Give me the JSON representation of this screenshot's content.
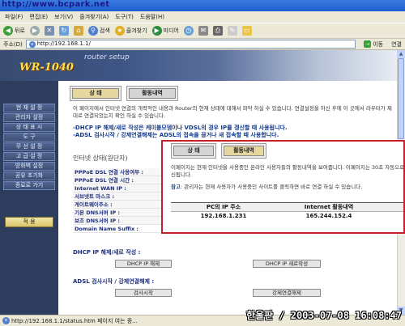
{
  "watermark": "http://www.bcpark.net",
  "menubar": [
    "파일(F)",
    "편집(E)",
    "보기(V)",
    "즐겨찾기(A)",
    "도구(T)",
    "도움말(H)"
  ],
  "toolbar": {
    "back": "뒤로",
    "search": "검색",
    "favorites": "즐겨찾기",
    "media": "미디어"
  },
  "address": {
    "label": "주소(D)",
    "url": "http://192.168.1.1/",
    "go": "이동",
    "links": "연결"
  },
  "logo": {
    "brand": "WR-1040",
    "tagline": "router setup"
  },
  "sidebar": {
    "items": [
      "현 재 설 정",
      "관리자 설정",
      "상 태 표 시",
      "도 구",
      "무 선 설 정",
      "고 급 설 정",
      "방화벽 설정",
      "공유 초기화",
      "종료로 가기"
    ],
    "apply": "적 용"
  },
  "tabs": {
    "status": "상 태",
    "activity": "활동내역"
  },
  "main": {
    "description": "이 페이지에서 인터넷 연결의 개략적인 내용과 Router의 현재 상태에 대해서 파악 하실 수 있습니다. 연결설정을 하신 후에 이 곳에서 라우터가 제대로 연결되었는지 확인 하실 수 있습니다.",
    "note1": "-DHCP IP 해제/새로 작성은 케이블모뎀이나 VDSL의 경우 IP를 갱신할 때 사용됩니다.",
    "note2": "-ADSL 검사시작 / 강제연결해제는 ADSL의 접속을 끊거나 새 접속할 때 사용합니다.",
    "status_title": "인터넷 상태(원단자)",
    "status_rows": [
      "PPPoE DSL 연결 사용여부 :",
      "PPPoE DSL 연결 시간 :",
      "Internet WAN IP :",
      "서브넷트 마스크 :",
      "게이트웨이주소 :",
      "기본 DNS서버 IP :",
      "보조 DNS서버 IP :",
      "Domain Name Suffix :"
    ],
    "dhcp_title": "DHCP IP 해제/새로 작성 :",
    "dhcp_release": "DHCP IP 해제",
    "dhcp_renew": "DHCP IP 새로작성",
    "adsl_title": "ADSL 검사시작 / 강제연결해제 :",
    "adsl_start": "검사시작",
    "adsl_disconnect": "강제연결해제"
  },
  "popup": {
    "description": "이페이지는 현재 인터넷을 사용중인 온라인 사용자들의 활동내역을 보여줍니다. 이페이지는 30초 자동으로 갱신됩니다.",
    "note_label": "참고",
    "note": ": 관리자는 현재 사용자가 사용중인 사이트를 클릭하면 바로 연결 하실 수 있습니다.",
    "col_ip": "PC의 IP 주소",
    "col_activity": "Internet 활동내역",
    "row_ip": "192.168.1.231",
    "row_activity": "165.244.152.4"
  },
  "statusbar": {
    "text": "http://192.168.1.1/status.htm 페이지 여는 중..."
  },
  "timestamp": "한울판 / 2003-07-08 16:08:47"
}
